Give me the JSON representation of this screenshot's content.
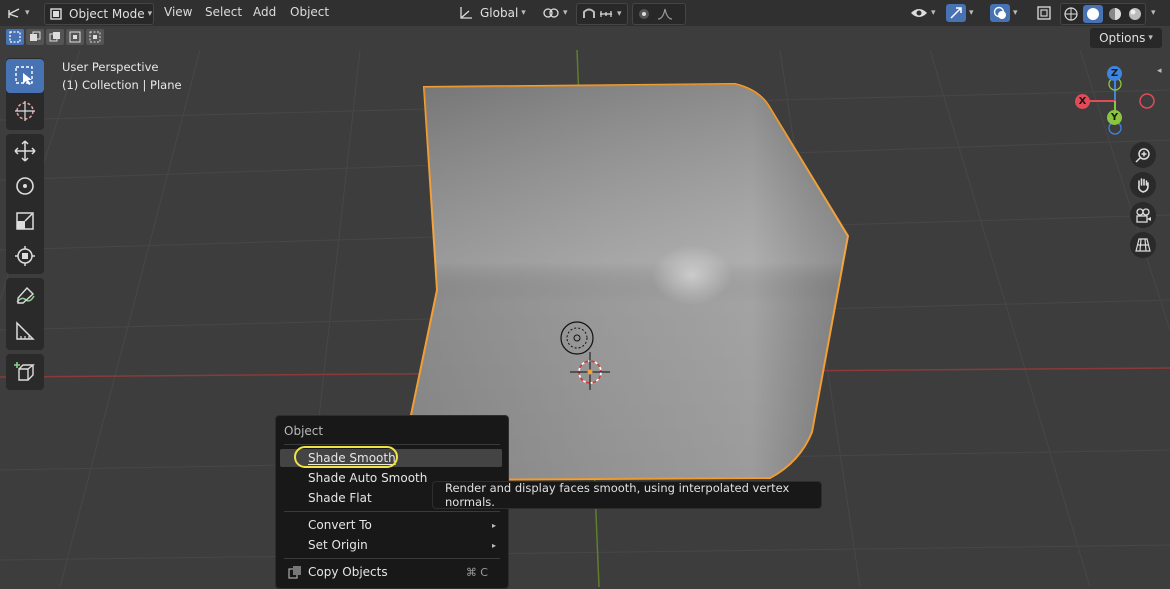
{
  "header": {
    "mode_label": "Object Mode",
    "menus": [
      "View",
      "Select",
      "Add",
      "Object"
    ],
    "transform_orientation": "Global",
    "options_label": "Options"
  },
  "viewport": {
    "perspective_label": "User Perspective",
    "collection_label": "(1) Collection | Plane"
  },
  "gizmo": {
    "axis_z": "Z",
    "axis_x": "X",
    "axis_y": "Y"
  },
  "colors": {
    "accent_blue": "#4772b3",
    "selection_outline": "#f5a035",
    "focus_ring": "#f0e442",
    "axis_x": "#e04b57",
    "axis_y": "#8bc53f",
    "axis_z": "#3d85e0"
  },
  "context_menu": {
    "title": "Object",
    "items": [
      {
        "label": "Shade Smooth"
      },
      {
        "label": "Shade Auto Smooth"
      },
      {
        "label": "Shade Flat"
      },
      {
        "label": "Convert To"
      },
      {
        "label": "Set Origin"
      },
      {
        "label": "Copy Objects",
        "shortcut": "⌘ C"
      }
    ]
  },
  "tooltip": {
    "text": "Render and display faces smooth, using interpolated vertex normals."
  },
  "icons": [
    "editor-type-icon",
    "object-mode-icon",
    "transform-orientation-icon",
    "pivot-icon",
    "snap-icon",
    "proportional-edit-icon",
    "visibility-icon",
    "gizmo-icon",
    "overlay-icon",
    "xray-icon",
    "shading-wireframe-icon",
    "shading-solid-icon",
    "shading-material-icon",
    "shading-rendered-icon",
    "select-box-icon",
    "cursor-icon",
    "move-icon",
    "rotate-icon",
    "scale-icon",
    "transform-icon",
    "annotate-icon",
    "measure-icon",
    "add-cube-icon",
    "zoom-icon",
    "hand-icon",
    "camera-icon",
    "grid-icon"
  ]
}
